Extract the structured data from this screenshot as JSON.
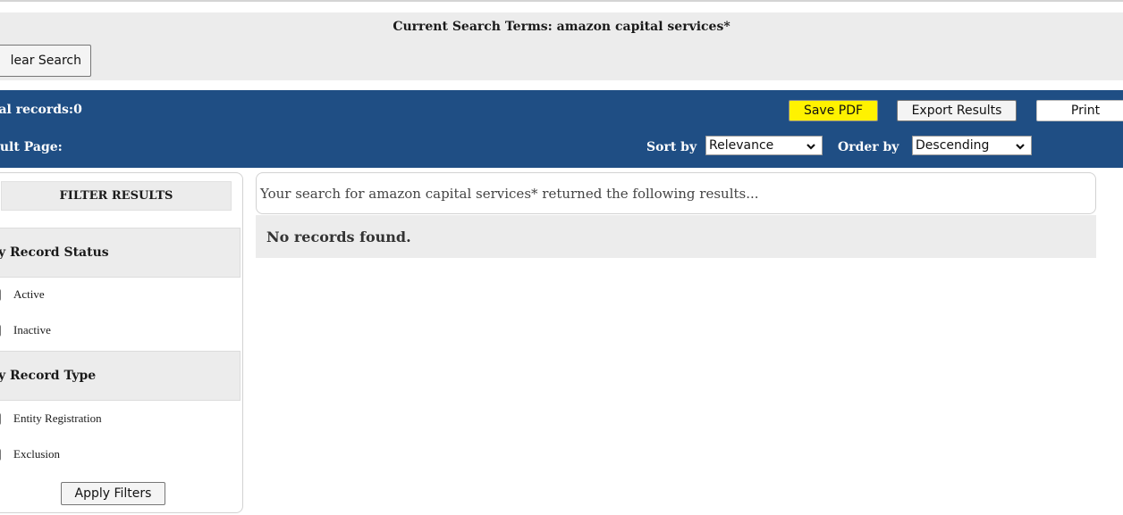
{
  "header": {
    "search_terms": "Current Search Terms: amazon capital services*",
    "clear_button": "lear Search"
  },
  "toolbar": {
    "total_records": "tal records:0",
    "result_page": "sult Page:",
    "save_pdf": "Save PDF",
    "export_results": "Export Results",
    "print": "Print",
    "sort_label": "Sort by",
    "sort_value": "Relevance",
    "order_label": "Order by",
    "order_value": "Descending",
    "accent_color": "#1f4e84",
    "highlight_color": "#fff200"
  },
  "filters": {
    "title": "FILTER RESULTS",
    "groups": [
      {
        "heading": "y Record Status",
        "options": [
          "Active",
          "Inactive"
        ]
      },
      {
        "heading": "y Record Type",
        "options": [
          "Entity Registration",
          "Exclusion"
        ]
      }
    ],
    "apply_button": "Apply Filters"
  },
  "results": {
    "summary": "Your search for amazon capital services* returned the following results...",
    "message": "No records found."
  }
}
